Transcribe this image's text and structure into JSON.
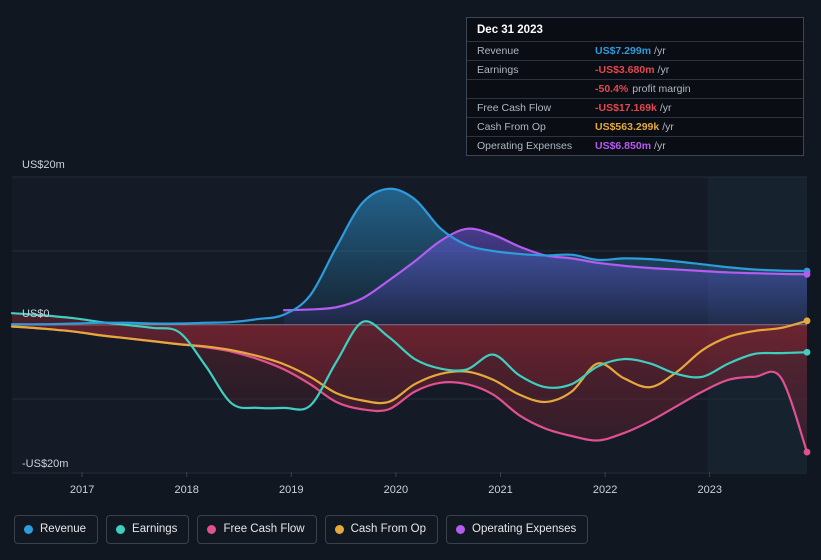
{
  "chart_data": {
    "type": "area",
    "title": "",
    "xlabel": "",
    "ylabel": "",
    "ylim": [
      -20,
      20
    ],
    "y_unit": "US$m",
    "grid": true,
    "legend_position": "bottom",
    "y_ticks": [
      {
        "value": 20,
        "label": "US$20m"
      },
      {
        "value": 0,
        "label": "US$0"
      },
      {
        "value": -20,
        "label": "-US$20m"
      }
    ],
    "x_ticks": [
      "2017",
      "2018",
      "2019",
      "2020",
      "2021",
      "2022",
      "2023"
    ],
    "x": [
      2016.4,
      2016.7,
      2017.0,
      2017.25,
      2017.5,
      2017.75,
      2018.0,
      2018.25,
      2018.5,
      2018.75,
      2019.0,
      2019.25,
      2019.5,
      2019.75,
      2020.0,
      2020.25,
      2020.5,
      2020.75,
      2021.0,
      2021.25,
      2021.5,
      2021.75,
      2022.0,
      2022.25,
      2022.5,
      2022.75,
      2023.0,
      2023.25,
      2023.5,
      2023.75,
      2024.0
    ],
    "series": [
      {
        "name": "Revenue",
        "color": "#2e9bdb",
        "values": [
          0.1,
          0.1,
          0.2,
          0.3,
          0.3,
          0.2,
          0.2,
          0.3,
          0.4,
          0.8,
          1.4,
          4.0,
          10.5,
          16.5,
          18.4,
          17.0,
          13.0,
          10.8,
          10.0,
          9.6,
          9.4,
          9.5,
          8.8,
          9.0,
          8.9,
          8.6,
          8.2,
          7.8,
          7.5,
          7.35,
          7.299
        ]
      },
      {
        "name": "Earnings",
        "color": "#3ecfc0",
        "values": [
          1.6,
          1.3,
          0.9,
          0.4,
          0.0,
          -0.4,
          -1.0,
          -5.5,
          -10.6,
          -11.2,
          -11.2,
          -10.9,
          -5.0,
          0.4,
          -1.6,
          -4.6,
          -5.9,
          -6.0,
          -4.0,
          -6.8,
          -8.4,
          -8.0,
          -5.6,
          -4.6,
          -5.2,
          -6.6,
          -7.0,
          -5.2,
          -3.9,
          -3.8,
          -3.68
        ]
      },
      {
        "name": "Free Cash Flow",
        "color": "#e0518f",
        "values": [
          -0.2,
          -0.5,
          -0.9,
          -1.4,
          -1.8,
          -2.2,
          -2.6,
          -3.0,
          -3.6,
          -4.6,
          -6.0,
          -8.0,
          -10.4,
          -11.4,
          -11.4,
          -9.0,
          -7.8,
          -8.0,
          -9.4,
          -12.2,
          -14.0,
          -15.0,
          -15.6,
          -14.6,
          -13.0,
          -11.0,
          -9.0,
          -7.4,
          -7.0,
          -7.1,
          -17.169
        ]
      },
      {
        "name": "Cash From Op",
        "color": "#e5a83c",
        "values": [
          -0.2,
          -0.5,
          -0.9,
          -1.4,
          -1.8,
          -2.2,
          -2.6,
          -2.9,
          -3.4,
          -4.2,
          -5.3,
          -7.0,
          -9.2,
          -10.2,
          -10.4,
          -8.0,
          -6.6,
          -6.3,
          -7.4,
          -9.4,
          -10.4,
          -9.0,
          -5.2,
          -7.2,
          -8.4,
          -6.4,
          -3.4,
          -1.6,
          -0.8,
          -0.4,
          0.563
        ]
      },
      {
        "name": "Operating Expenses",
        "color": "#b45cf0",
        "values": [
          null,
          null,
          null,
          null,
          null,
          null,
          null,
          null,
          null,
          null,
          2.0,
          2.1,
          2.4,
          3.6,
          6.0,
          8.6,
          11.4,
          13.0,
          12.2,
          10.6,
          9.4,
          9.0,
          8.4,
          8.0,
          7.7,
          7.5,
          7.3,
          7.1,
          7.0,
          6.9,
          6.85
        ]
      }
    ],
    "forecast_start_x": 2023.05
  },
  "tooltip": {
    "title": "Dec 31 2023",
    "rows": [
      {
        "key": "Revenue",
        "value": "US$7.299m",
        "unit": "/yr",
        "color": "#2e9bdb"
      },
      {
        "key": "Earnings",
        "value": "-US$3.680m",
        "unit": "/yr",
        "color": "#e3484f"
      },
      {
        "key": "",
        "value": "-50.4%",
        "unit": "",
        "sub": "profit margin",
        "color": "#e3484f"
      },
      {
        "key": "Free Cash Flow",
        "value": "-US$17.169k",
        "unit": "/yr",
        "color": "#e3484f"
      },
      {
        "key": "Cash From Op",
        "value": "US$563.299k",
        "unit": "/yr",
        "color": "#e5a83c"
      },
      {
        "key": "Operating Expenses",
        "value": "US$6.850m",
        "unit": "/yr",
        "color": "#b45cf0"
      }
    ]
  },
  "legend": {
    "items": [
      {
        "label": "Revenue",
        "color": "#2e9bdb"
      },
      {
        "label": "Earnings",
        "color": "#3ecfc0"
      },
      {
        "label": "Free Cash Flow",
        "color": "#e0518f"
      },
      {
        "label": "Cash From Op",
        "color": "#e5a83c"
      },
      {
        "label": "Operating Expenses",
        "color": "#b45cf0"
      }
    ]
  }
}
